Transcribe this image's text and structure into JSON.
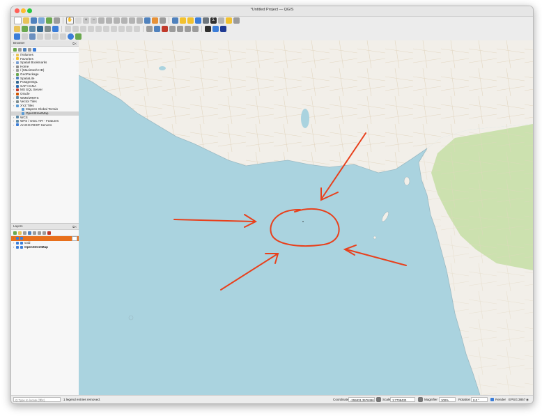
{
  "window": {
    "title": "*Untitled Project — QGIS"
  },
  "browser": {
    "title": "Browser",
    "items": [
      {
        "label": "/Volumes",
        "indent": 0,
        "icon": "folder-icon",
        "color": "#e8c35a"
      },
      {
        "label": "Favorites",
        "indent": 0,
        "icon": "star-icon",
        "color": "#f2c12e"
      },
      {
        "label": "Spatial Bookmarks",
        "indent": 0,
        "icon": "bookmark-icon",
        "color": "#7a9fd1"
      },
      {
        "label": "Home",
        "indent": 0,
        "icon": "home-icon",
        "color": "#8e8e8e"
      },
      {
        "label": "/ (Macintosh HD)",
        "indent": 0,
        "icon": "drive-icon",
        "color": "#9a9a9a"
      },
      {
        "label": "GeoPackage",
        "indent": 0,
        "icon": "geopackage-icon",
        "color": "#6aa84f"
      },
      {
        "label": "SpatiaLite",
        "indent": 0,
        "icon": "spatialite-icon",
        "color": "#4f81bd"
      },
      {
        "label": "PostgreSQL",
        "indent": 0,
        "icon": "postgresql-icon",
        "color": "#336791"
      },
      {
        "label": "SAP HANA",
        "indent": 0,
        "icon": "saphana-icon",
        "color": "#2b6cb0"
      },
      {
        "label": "MS SQL Server",
        "indent": 0,
        "icon": "mssql-icon",
        "color": "#c0392b"
      },
      {
        "label": "Oracle",
        "indent": 0,
        "icon": "oracle-icon",
        "color": "#d35400"
      },
      {
        "label": "WMS/WMTS",
        "indent": 0,
        "icon": "wms-icon",
        "color": "#5d8aa8"
      },
      {
        "label": "Vector Tiles",
        "indent": 0,
        "icon": "vector-tiles-icon",
        "color": "#7f8c8d"
      },
      {
        "label": "XYZ Tiles",
        "indent": 0,
        "icon": "xyz-tiles-icon",
        "color": "#5b9bd5"
      },
      {
        "label": "Mapzen Global Terrain",
        "indent": 1,
        "icon": "tile-layer-icon",
        "color": "#5b9bd5"
      },
      {
        "label": "OpenStreetMap",
        "indent": 1,
        "icon": "tile-layer-icon",
        "color": "#5b9bd5",
        "selected": true
      },
      {
        "label": "WCS",
        "indent": 0,
        "icon": "wcs-icon",
        "color": "#5d8aa8"
      },
      {
        "label": "WFS / OGC API - Features",
        "indent": 0,
        "icon": "wfs-icon",
        "color": "#5d8aa8"
      },
      {
        "label": "ArcGIS REST Servers",
        "indent": 0,
        "icon": "arcgis-icon",
        "color": "#3b7dd8"
      }
    ]
  },
  "layers": {
    "title": "Layers",
    "items": [
      {
        "label": "",
        "checked": true,
        "highlighted": true
      },
      {
        "label": "void",
        "checked": true,
        "highlighted": false
      },
      {
        "label": "OpenStreetMap",
        "checked": true,
        "highlighted": false,
        "bold": true
      }
    ]
  },
  "status": {
    "locate_placeholder": "Q  Type to locate (⌘K)",
    "message": "1 legend entries removed.",
    "coordinate_label": "Coordinate",
    "coordinate_value": "-255831,3578496",
    "scale_label": "Scale",
    "scale_value": "1:7708430",
    "magnifier_label": "Magnifier",
    "magnifier_value": "100%",
    "rotation_label": "Rotation",
    "rotation_value": "0.0 °",
    "render_label": "Render",
    "crs_label": "EPSG:3857"
  },
  "colors": {
    "sea": "#aad3df",
    "land": "#f2efe9",
    "forest": "#c8dfa8",
    "annotation": "#e8401c",
    "selection": "#e8701c"
  }
}
